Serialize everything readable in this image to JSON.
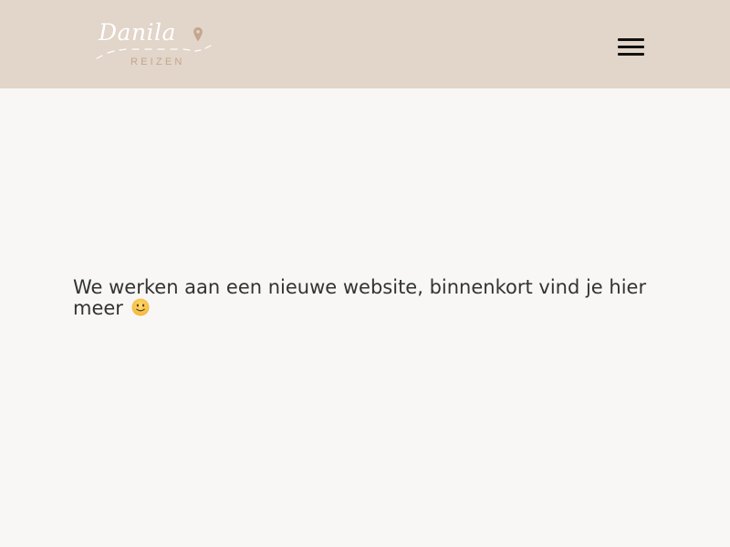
{
  "colors": {
    "header_bg": "#e2d5c9",
    "page_bg": "#f8f7f6",
    "logo_accent": "#c4a68e",
    "text": "#333333",
    "menu_icon": "#111111"
  },
  "header": {
    "logo": {
      "script_text": "Danila",
      "sub_text": "REIZEN",
      "pin_icon": "map-pin-icon"
    },
    "menu_icon": "hamburger-menu-icon"
  },
  "main": {
    "message": "We werken aan een nieuwe website, binnenkort vind je hier meer",
    "emoji_icon": "slightly-smiling-face-icon"
  }
}
